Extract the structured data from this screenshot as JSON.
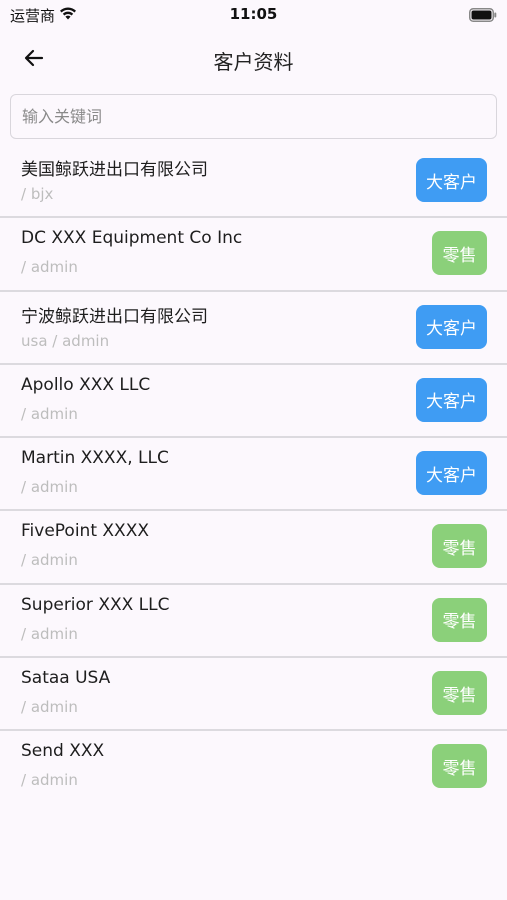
{
  "status_bar": {
    "carrier": "运营商",
    "time": "11:05"
  },
  "header": {
    "title": "客户资料"
  },
  "search": {
    "placeholder": "输入关键词",
    "value": ""
  },
  "colors": {
    "big_customer_badge": "#3f9cf3",
    "retail_badge": "#8bd07a",
    "background": "#fcf8fd"
  },
  "customers": [
    {
      "name": "美国鲸跃进出口有限公司",
      "sub": " / bjx",
      "tag": "大客户",
      "tag_type": "big"
    },
    {
      "name": "DC XXX Equipment Co Inc",
      "sub": " / admin",
      "tag": "零售",
      "tag_type": "retail"
    },
    {
      "name": "宁波鲸跃进出口有限公司",
      "sub": "usa / admin",
      "tag": "大客户",
      "tag_type": "big"
    },
    {
      "name": "Apollo XXX LLC",
      "sub": " / admin",
      "tag": "大客户",
      "tag_type": "big"
    },
    {
      "name": "Martin XXXX, LLC",
      "sub": " / admin",
      "tag": "大客户",
      "tag_type": "big"
    },
    {
      "name": "FivePoint XXXX",
      "sub": " / admin",
      "tag": "零售",
      "tag_type": "retail"
    },
    {
      "name": "Superior XXX LLC",
      "sub": " / admin",
      "tag": "零售",
      "tag_type": "retail"
    },
    {
      "name": "Sataa USA",
      "sub": " / admin",
      "tag": "零售",
      "tag_type": "retail"
    },
    {
      "name": "Send XXX",
      "sub": " / admin",
      "tag": "零售",
      "tag_type": "retail"
    }
  ]
}
